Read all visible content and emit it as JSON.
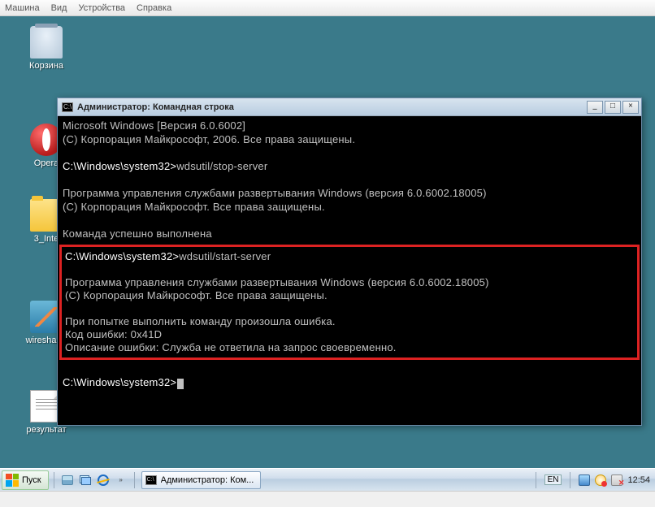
{
  "vm_menu": {
    "items": [
      "Машина",
      "Вид",
      "Устройства",
      "Справка"
    ]
  },
  "desktop": {
    "icons": {
      "recycle": "Корзина",
      "opera": "Opera",
      "folder": "3_Inte",
      "wireshark": "wireshark-",
      "result": "результат"
    }
  },
  "cmd": {
    "title_prefix": "Администратор: ",
    "title": "Командная строка",
    "icon_glyph": "C:\\",
    "lines": {
      "l1": "Microsoft Windows [Версия 6.0.6002]",
      "l2": "(C) Корпорация Майкрософт, 2006. Все права защищены.",
      "p1a": "C:\\Windows\\system32>",
      "p1b": "wdsutil/stop-server",
      "l3": "Программа управления службами развертывания Windows (версия 6.0.6002.18005)",
      "l4": "(C) Корпорация Майкрософт. Все права защищены.",
      "l5": "Команда успешно выполнена",
      "p2a": "C:\\Windows\\system32>",
      "p2b": "wdsutil/start-server",
      "l6": "Программа управления службами развертывания Windows (версия 6.0.6002.18005)",
      "l7": "(C) Корпорация Майкрософт. Все права защищены.",
      "l8": "При попытке выполнить команду произошла ошибка.",
      "l9": "Код ошибки: 0x41D",
      "l10": "Описание ошибки: Служба не ответила на запрос своевременно.",
      "p3": "C:\\Windows\\system32>"
    },
    "btn_min": "_",
    "btn_max": "□",
    "btn_close": "×"
  },
  "taskbar": {
    "start": "Пуск",
    "task_label": "Администратор: Ком...",
    "lang": "EN",
    "clock": "12:54",
    "ql_chevron": "»"
  }
}
